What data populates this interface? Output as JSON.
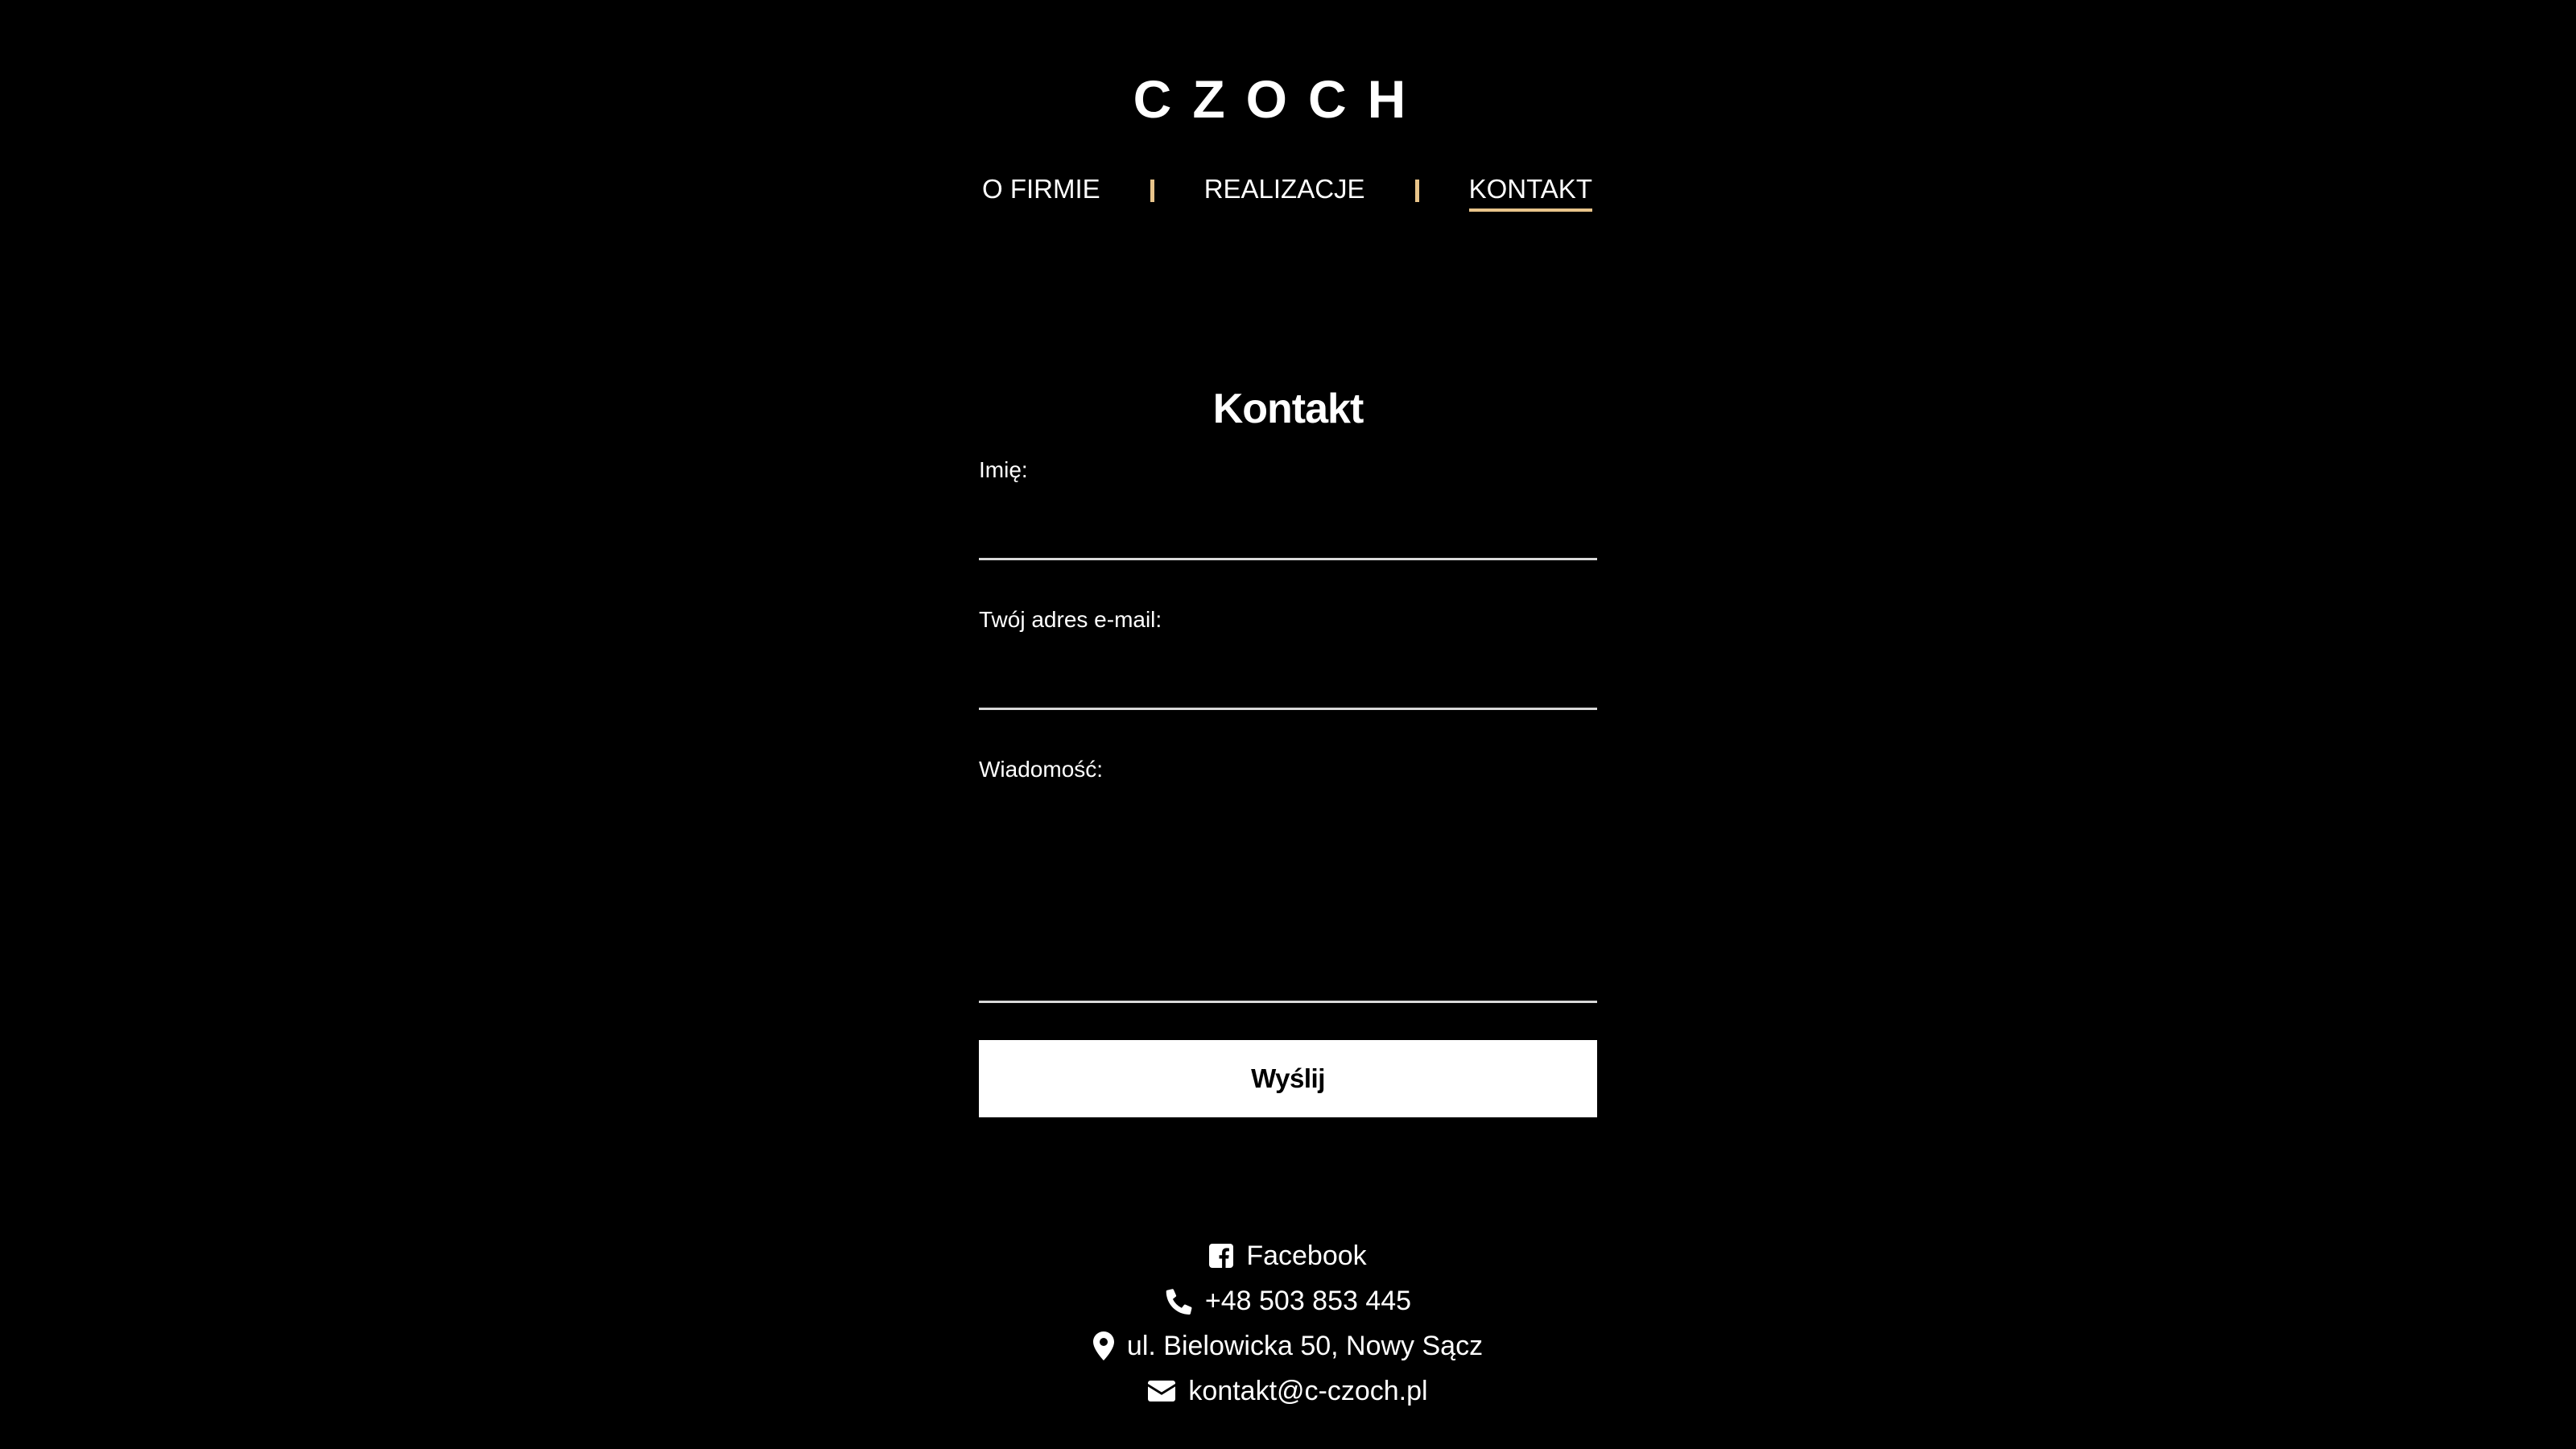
{
  "header": {
    "logo": "CZOCH",
    "nav": [
      {
        "label": "O FIRMIE",
        "active": false
      },
      {
        "label": "REALIZACJE",
        "active": false
      },
      {
        "label": "KONTAKT",
        "active": true
      }
    ],
    "accent_color": "#e8c48a"
  },
  "form": {
    "title": "Kontakt",
    "name_label": "Imię:",
    "name_value": "",
    "email_label": "Twój adres e-mail:",
    "email_value": "",
    "message_label": "Wiadomość:",
    "message_value": "",
    "submit_label": "Wyślij"
  },
  "contact": {
    "facebook": {
      "icon": "facebook-icon",
      "label": "Facebook"
    },
    "phone": {
      "icon": "phone-icon",
      "label": "+48 503 853 445"
    },
    "address": {
      "icon": "map-pin-icon",
      "label": "ul. Bielowicka 50, Nowy Sącz"
    },
    "email": {
      "icon": "envelope-icon",
      "label": "kontakt@c-czoch.pl"
    }
  }
}
